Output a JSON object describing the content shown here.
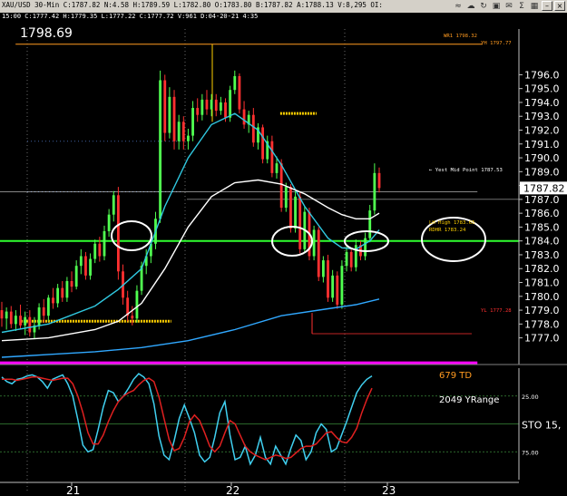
{
  "window": {
    "title": "XAU/USD  30-Min  C:1787.82  N:4.58  H:1789.59  L:1782.80  O:1783.80  B:1787.82  A:1788.13  V:8,295  OI:",
    "subtitle": "15:00  C:1777.42  H:1779.35  L:1777.22  C:1777.72  V:961  D:04-20-21  4:35",
    "icons": [
      "wifi-icon",
      "cloud-icon",
      "sync-icon",
      "network-icon",
      "mail-icon",
      "sum-icon",
      "image-icon",
      "minimize-icon",
      "close-icon"
    ]
  },
  "colors": {
    "up": "#50ff50",
    "down": "#ff3030",
    "ma_fast": "#30c8e0",
    "ma_slow": "#ffffff",
    "ma_long": "#30a8ff",
    "magenta": "#ff00ff",
    "level_green": "#30ff30",
    "orange": "#ff9a20",
    "yellow": "#ffd000",
    "stoch_k": "#40d0f0",
    "stoch_d": "#e02020"
  },
  "chart_data": [
    {
      "type": "candlestick",
      "title": "1798.69",
      "x_ticks": [
        "21",
        "22",
        "23"
      ],
      "y_ticks": [
        1777,
        1778,
        1779,
        1780,
        1781,
        1782,
        1783,
        1784,
        1785,
        1786,
        1787,
        1788,
        1789,
        1790,
        1791,
        1792,
        1793,
        1794,
        1795,
        1796
      ],
      "ylim": [
        1775.6,
        1799.3
      ],
      "last_price": 1787.82,
      "last_price_label": "1787.82",
      "candles": [
        [
          1779.0,
          1779.6,
          1777.8,
          1778.4
        ],
        [
          1778.4,
          1779.2,
          1777.6,
          1778.9
        ],
        [
          1778.9,
          1779.3,
          1777.7,
          1778.0
        ],
        [
          1778.0,
          1779.0,
          1777.5,
          1778.6
        ],
        [
          1778.6,
          1779.4,
          1777.6,
          1777.9
        ],
        [
          1777.9,
          1778.9,
          1777.2,
          1778.5
        ],
        [
          1778.5,
          1779.0,
          1777.1,
          1777.4
        ],
        [
          1777.4,
          1778.5,
          1776.9,
          1777.9
        ],
        [
          1777.9,
          1779.5,
          1777.6,
          1779.2
        ],
        [
          1779.2,
          1779.8,
          1778.1,
          1778.6
        ],
        [
          1778.6,
          1780.1,
          1778.2,
          1779.9
        ],
        [
          1779.9,
          1780.6,
          1779.1,
          1779.5
        ],
        [
          1779.5,
          1780.9,
          1779.2,
          1780.6
        ],
        [
          1780.6,
          1781.1,
          1779.6,
          1779.9
        ],
        [
          1779.9,
          1781.4,
          1779.6,
          1781.1
        ],
        [
          1781.1,
          1781.8,
          1780.3,
          1780.7
        ],
        [
          1780.7,
          1782.6,
          1780.5,
          1782.2
        ],
        [
          1782.2,
          1783.4,
          1781.6,
          1782.9
        ],
        [
          1782.9,
          1783.2,
          1781.2,
          1781.5
        ],
        [
          1781.5,
          1783.1,
          1781.2,
          1782.7
        ],
        [
          1782.7,
          1784.1,
          1782.4,
          1783.8
        ],
        [
          1783.8,
          1784.3,
          1782.5,
          1782.9
        ],
        [
          1782.9,
          1785.1,
          1782.6,
          1784.7
        ],
        [
          1784.7,
          1786.3,
          1784.3,
          1785.9
        ],
        [
          1785.9,
          1787.6,
          1785.4,
          1787.3
        ],
        [
          1787.3,
          1787.9,
          1781.2,
          1781.8
        ],
        [
          1781.8,
          1782.3,
          1779.4,
          1779.9
        ],
        [
          1779.9,
          1780.4,
          1778.2,
          1778.6
        ],
        [
          1778.6,
          1779.3,
          1777.9,
          1778.4
        ],
        [
          1778.4,
          1780.8,
          1778.1,
          1780.4
        ],
        [
          1780.4,
          1782.5,
          1780.1,
          1782.2
        ],
        [
          1782.2,
          1783.4,
          1781.6,
          1782.9
        ],
        [
          1782.9,
          1784.1,
          1782.4,
          1783.8
        ],
        [
          1783.8,
          1786.1,
          1783.4,
          1785.6
        ],
        [
          1785.6,
          1796.3,
          1785.3,
          1795.6
        ],
        [
          1795.6,
          1796.0,
          1791.2,
          1791.8
        ],
        [
          1791.8,
          1795.1,
          1791.4,
          1794.4
        ],
        [
          1794.4,
          1794.9,
          1790.6,
          1791.2
        ],
        [
          1791.2,
          1793.1,
          1790.6,
          1792.6
        ],
        [
          1792.6,
          1793.0,
          1790.6,
          1791.2
        ],
        [
          1791.2,
          1792.1,
          1790.6,
          1791.6
        ],
        [
          1791.6,
          1794.1,
          1791.2,
          1793.6
        ],
        [
          1793.6,
          1794.3,
          1792.6,
          1793.1
        ],
        [
          1793.1,
          1794.6,
          1792.7,
          1794.2
        ],
        [
          1794.2,
          1794.9,
          1793.1,
          1793.5
        ],
        [
          1793.5,
          1794.6,
          1793.0,
          1794.2
        ],
        [
          1794.2,
          1794.6,
          1793.0,
          1793.4
        ],
        [
          1793.4,
          1794.4,
          1793.1,
          1794.0
        ],
        [
          1794.0,
          1794.3,
          1792.6,
          1792.9
        ],
        [
          1792.9,
          1795.2,
          1792.6,
          1794.9
        ],
        [
          1794.9,
          1796.3,
          1794.6,
          1795.9
        ],
        [
          1795.9,
          1796.1,
          1793.2,
          1793.5
        ],
        [
          1793.5,
          1794.1,
          1792.1,
          1792.4
        ],
        [
          1792.4,
          1793.4,
          1791.8,
          1793.1
        ],
        [
          1793.1,
          1793.6,
          1790.8,
          1791.1
        ],
        [
          1791.1,
          1792.5,
          1790.6,
          1792.2
        ],
        [
          1792.2,
          1792.4,
          1789.6,
          1789.9
        ],
        [
          1789.9,
          1791.6,
          1789.6,
          1791.2
        ],
        [
          1791.2,
          1791.6,
          1788.6,
          1788.9
        ],
        [
          1788.9,
          1790.1,
          1788.5,
          1789.6
        ],
        [
          1789.6,
          1789.9,
          1786.1,
          1786.4
        ],
        [
          1786.4,
          1788.2,
          1786.1,
          1787.9
        ],
        [
          1787.9,
          1788.1,
          1784.6,
          1784.9
        ],
        [
          1784.9,
          1787.6,
          1784.6,
          1787.2
        ],
        [
          1787.2,
          1787.5,
          1783.1,
          1783.4
        ],
        [
          1783.4,
          1786.5,
          1783.1,
          1786.1
        ],
        [
          1786.1,
          1786.4,
          1782.6,
          1782.9
        ],
        [
          1782.9,
          1785.1,
          1782.6,
          1784.8
        ],
        [
          1784.8,
          1785.0,
          1781.1,
          1781.4
        ],
        [
          1781.4,
          1782.9,
          1781.0,
          1782.6
        ],
        [
          1782.6,
          1783.0,
          1779.6,
          1779.9
        ],
        [
          1779.9,
          1781.9,
          1779.6,
          1781.5
        ],
        [
          1781.5,
          1781.8,
          1779.1,
          1779.4
        ],
        [
          1779.4,
          1782.6,
          1779.1,
          1782.2
        ],
        [
          1782.2,
          1783.6,
          1781.8,
          1783.2
        ],
        [
          1783.2,
          1783.5,
          1781.8,
          1782.1
        ],
        [
          1782.1,
          1784.1,
          1781.8,
          1783.7
        ],
        [
          1783.7,
          1784.0,
          1782.6,
          1782.9
        ],
        [
          1782.9,
          1784.6,
          1782.6,
          1784.2
        ],
        [
          1784.2,
          1786.6,
          1783.9,
          1786.2
        ],
        [
          1786.2,
          1789.6,
          1785.9,
          1788.9
        ],
        [
          1788.9,
          1789.3,
          1787.5,
          1787.82
        ]
      ],
      "overlays": [
        {
          "name": "fast-ma",
          "color_key": "ma_fast",
          "points": [
            [
              0,
              1777.4
            ],
            [
              10,
              1778.0
            ],
            [
              20,
              1779.3
            ],
            [
              25,
              1780.5
            ],
            [
              30,
              1782.0
            ],
            [
              35,
              1786.5
            ],
            [
              40,
              1790.0
            ],
            [
              45,
              1792.4
            ],
            [
              50,
              1793.2
            ],
            [
              55,
              1792.0
            ],
            [
              60,
              1789.5
            ],
            [
              65,
              1786.5
            ],
            [
              70,
              1784.2
            ],
            [
              73,
              1783.5
            ],
            [
              76,
              1783.4
            ],
            [
              79,
              1784.0
            ],
            [
              81,
              1784.8
            ]
          ]
        },
        {
          "name": "slow-ma",
          "color_key": "ma_slow",
          "points": [
            [
              0,
              1776.8
            ],
            [
              10,
              1777.0
            ],
            [
              20,
              1777.6
            ],
            [
              25,
              1778.2
            ],
            [
              30,
              1779.5
            ],
            [
              35,
              1782.0
            ],
            [
              40,
              1785.0
            ],
            [
              45,
              1787.2
            ],
            [
              50,
              1788.2
            ],
            [
              55,
              1788.4
            ],
            [
              60,
              1788.1
            ],
            [
              65,
              1787.4
            ],
            [
              70,
              1786.4
            ],
            [
              73,
              1785.9
            ],
            [
              76,
              1785.6
            ],
            [
              79,
              1785.6
            ],
            [
              81,
              1786.0
            ]
          ]
        },
        {
          "name": "long-ma",
          "color_key": "ma_long",
          "points": [
            [
              0,
              1775.6
            ],
            [
              5,
              1775.7
            ],
            [
              10,
              1775.8
            ],
            [
              20,
              1776.0
            ],
            [
              30,
              1776.3
            ],
            [
              40,
              1776.8
            ],
            [
              50,
              1777.6
            ],
            [
              60,
              1778.6
            ],
            [
              70,
              1779.1
            ],
            [
              76,
              1779.4
            ],
            [
              81,
              1779.8
            ]
          ]
        }
      ],
      "levels": [
        {
          "name": "green-level",
          "value": 1784.0,
          "color_key": "level_green",
          "from": 0,
          "to": 1.0
        },
        {
          "name": "magenta-level",
          "value": 1775.2,
          "color_key": "magenta",
          "from": 0,
          "to": 0.92
        },
        {
          "name": "orange-top-level",
          "value": 1798.2,
          "color_key": "orange",
          "from": 0.03,
          "to": 0.93
        },
        {
          "name": "yellow-dotted-1",
          "value": 1793.2,
          "color_key": "yellow",
          "from": 0.54,
          "to": 0.61
        },
        {
          "name": "yellow-dotted-2",
          "value": 1778.2,
          "color_key": "yellow",
          "from": 0.04,
          "to": 0.33
        },
        {
          "name": "yesterday-mid-line",
          "value": 1787.55,
          "color_key": "ma_slow",
          "from": 0.0,
          "to": 0.92
        }
      ],
      "annotations": [
        {
          "text": "WR1 1798.32",
          "value": 1798.32,
          "color_key": "orange"
        },
        {
          "text": "YH 1797.77",
          "value": 1797.77,
          "color_key": "orange"
        },
        {
          "text": "← Yest Mid Point 1787.53",
          "value": 1787.53,
          "color_key": "ma_slow"
        },
        {
          "text": "LH High 1783.65",
          "value": 1784.1,
          "color_key": "yellow"
        },
        {
          "text": "RDHR 1783.24",
          "value": 1783.3,
          "color_key": "yellow"
        },
        {
          "text": "YL 1777.28",
          "value": 1777.28,
          "color_key": "down"
        }
      ]
    },
    {
      "type": "line",
      "title": "",
      "y_ticks": [
        25.0,
        50.0,
        75.0
      ],
      "y_tick_labels": [
        "25.00",
        "STO 15,",
        "75.00"
      ],
      "ylim": [
        0,
        100
      ],
      "inverted": true,
      "text_labels": [
        "679 TD",
        "2049 YRange"
      ],
      "series": [
        {
          "color_key": "stoch_k",
          "values": [
            8,
            12,
            14,
            10,
            9,
            7,
            6,
            8,
            12,
            18,
            10,
            8,
            6,
            14,
            25,
            46,
            69,
            75,
            73,
            55,
            35,
            20,
            22,
            30,
            25,
            18,
            10,
            5,
            8,
            14,
            32,
            61,
            78,
            82,
            65,
            45,
            33,
            45,
            58,
            78,
            84,
            80,
            62,
            40,
            30,
            60,
            82,
            80,
            70,
            86,
            78,
            62,
            80,
            86,
            70,
            78,
            86,
            72,
            60,
            65,
            82,
            75,
            58,
            50,
            55,
            75,
            72,
            60,
            48,
            35,
            22,
            15,
            10,
            7
          ]
        },
        {
          "color_key": "stoch_d",
          "values": [
            10,
            10,
            10,
            11,
            10,
            9,
            8,
            8,
            9,
            10,
            11,
            10,
            9,
            9,
            14,
            25,
            40,
            58,
            68,
            68,
            60,
            48,
            38,
            30,
            25,
            22,
            20,
            15,
            11,
            9,
            12,
            26,
            45,
            64,
            74,
            72,
            62,
            48,
            42,
            47,
            58,
            70,
            75,
            70,
            58,
            47,
            50,
            60,
            70,
            75,
            78,
            80,
            82,
            80,
            78,
            79,
            81,
            80,
            76,
            72,
            70,
            70,
            68,
            63,
            58,
            57,
            62,
            66,
            67,
            62,
            54,
            40,
            28,
            18
          ]
        }
      ]
    }
  ]
}
